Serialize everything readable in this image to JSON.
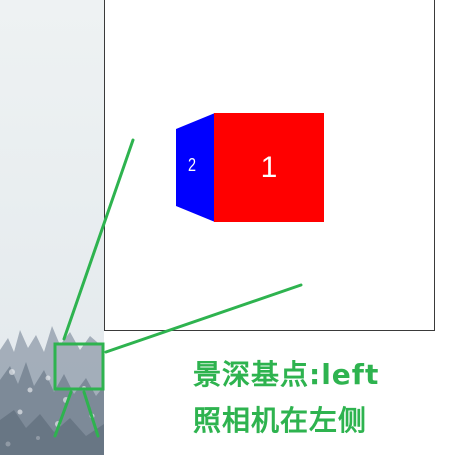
{
  "faces": {
    "front": {
      "label": "1",
      "color": "#ff0000"
    },
    "side": {
      "label": "2",
      "color": "#0000ff"
    }
  },
  "caption": {
    "line1": "景深基点:left",
    "line2": "照相机在左侧"
  },
  "colors": {
    "accent_green": "#2eb34f",
    "viewport_border": "#3a3a3a"
  },
  "icons": {
    "camera": "camera-icon"
  }
}
